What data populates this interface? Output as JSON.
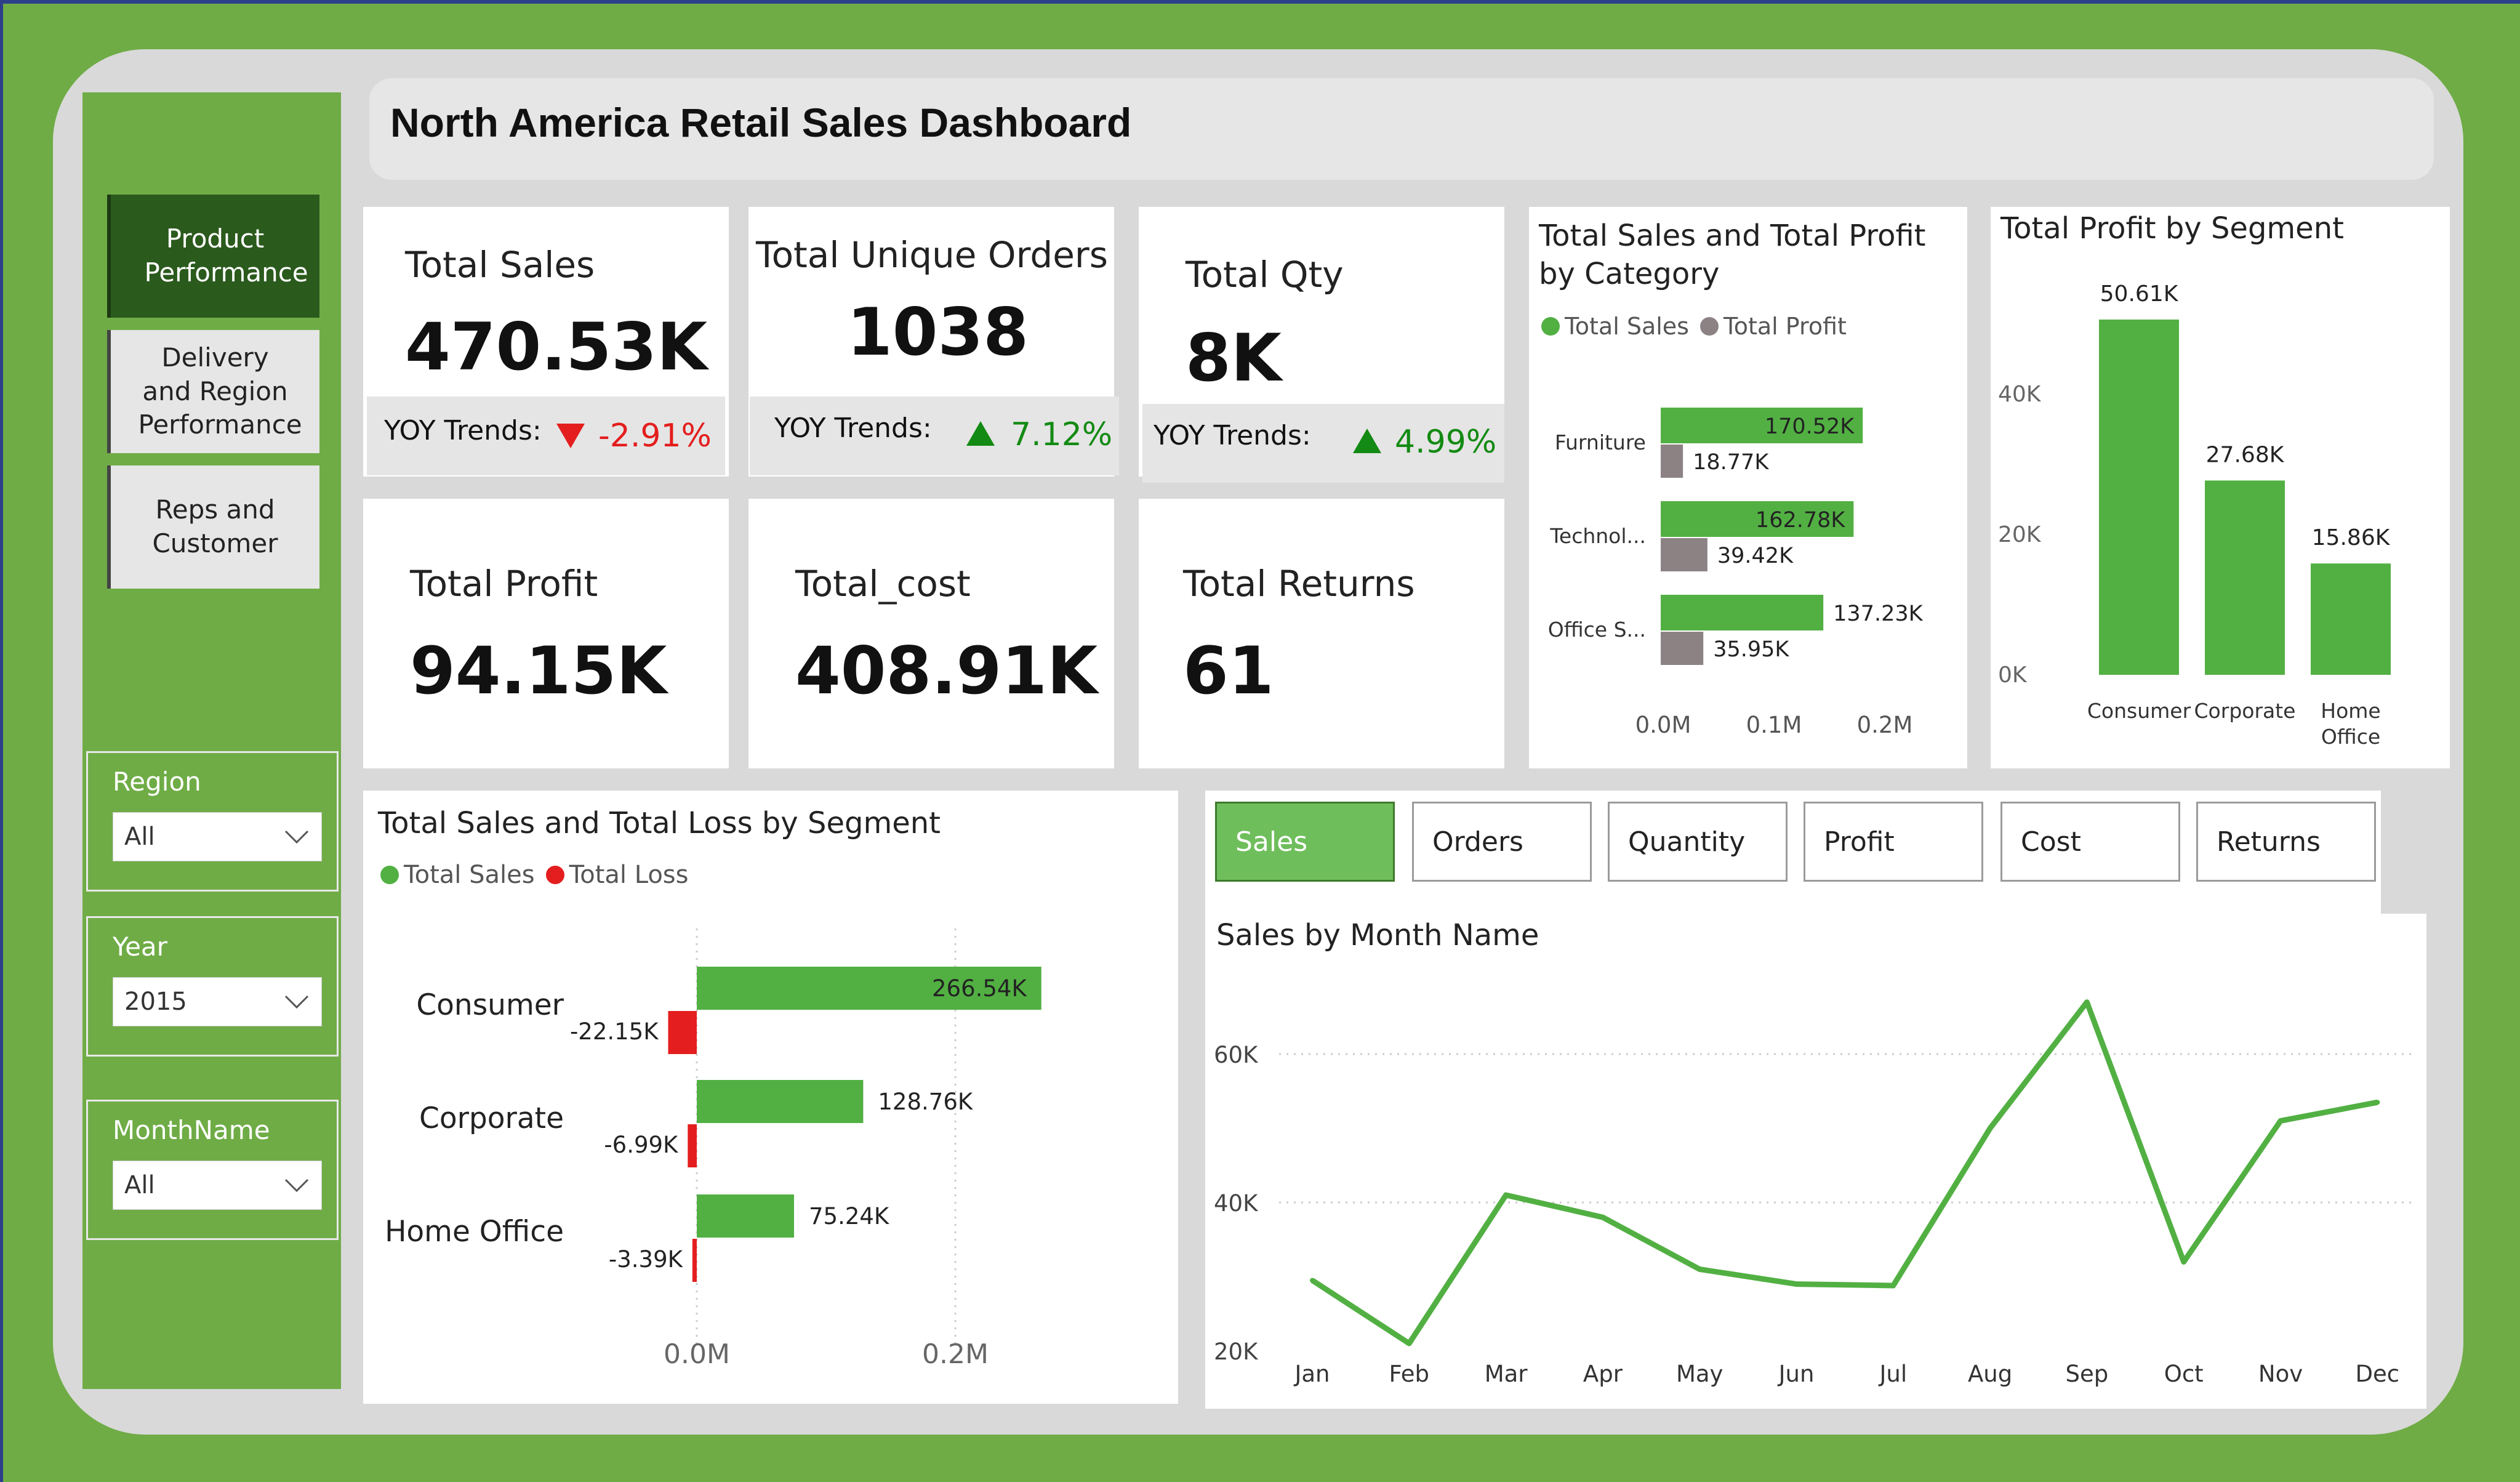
{
  "title": "North America Retail Sales Dashboard",
  "nav": {
    "product": "Product Performance",
    "delivery": "Delivery and Region Performance",
    "reps": "Reps and Customer"
  },
  "slicers": {
    "region": {
      "label": "Region",
      "value": "All"
    },
    "year": {
      "label": "Year",
      "value": "2015"
    },
    "month": {
      "label": "MonthName",
      "value": "All"
    }
  },
  "kpis": {
    "sales": {
      "label": "Total Sales",
      "value": "470.53K",
      "yoy_label": "YOY Trends:",
      "yoy": "-2.91%",
      "direction": "down"
    },
    "orders": {
      "label": "Total Unique Orders",
      "value": "1038",
      "yoy_label": "YOY Trends:",
      "yoy": "7.12%",
      "direction": "up"
    },
    "qty": {
      "label": "Total Qty",
      "value": "8K",
      "yoy_label": "YOY Trends:",
      "yoy": "4.99%",
      "direction": "up"
    },
    "profit": {
      "label": "Total Profit",
      "value": "94.15K"
    },
    "cost": {
      "label": "Total_cost",
      "value": "408.91K"
    },
    "returns": {
      "label": "Total Returns",
      "value": "61"
    }
  },
  "tabs": [
    "Sales",
    "Orders",
    "Quantity",
    "Profit",
    "Cost",
    "Returns"
  ],
  "colors": {
    "green": "#52b043",
    "grey": "#8c8284",
    "red": "#e41e1e",
    "accent": "#6fac46"
  },
  "chart_data": [
    {
      "id": "category",
      "type": "bar",
      "title": "Total Sales and Total Profit by Category",
      "legend": [
        "Total Sales",
        "Total Profit"
      ],
      "categories": [
        "Furniture",
        "Technol...",
        "Office S..."
      ],
      "series": [
        {
          "name": "Total Sales",
          "values": [
            170520,
            162780,
            137230
          ],
          "labels": [
            "170.52K",
            "162.78K",
            "137.23K"
          ]
        },
        {
          "name": "Total Profit",
          "values": [
            18770,
            39420,
            35950
          ],
          "labels": [
            "18.77K",
            "39.42K",
            "35.95K"
          ]
        }
      ],
      "xticks": [
        "0.0M",
        "0.1M",
        "0.2M"
      ],
      "xlim": [
        0,
        200000
      ]
    },
    {
      "id": "segment_profit",
      "type": "bar",
      "title": "Total Profit by Segment",
      "categories": [
        "Consumer",
        "Corporate",
        "Home Office"
      ],
      "values": [
        50610,
        27680,
        15860
      ],
      "labels": [
        "50.61K",
        "27.68K",
        "15.86K"
      ],
      "yticks": [
        "0K",
        "20K",
        "40K"
      ],
      "ylim": [
        0,
        50610
      ]
    },
    {
      "id": "segment_loss",
      "type": "bar",
      "title": "Total Sales and Total Loss by Segment",
      "legend": [
        "Total Sales",
        "Total Loss"
      ],
      "categories": [
        "Consumer",
        "Corporate",
        "Home Office"
      ],
      "series": [
        {
          "name": "Total Sales",
          "values": [
            266540,
            128760,
            75240
          ],
          "labels": [
            "266.54K",
            "128.76K",
            "75.24K"
          ]
        },
        {
          "name": "Total Loss",
          "values": [
            -22150,
            -6990,
            -3390
          ],
          "labels": [
            "-22.15K",
            "-6.99K",
            "-3.39K"
          ]
        }
      ],
      "xticks": [
        "0.0M",
        "0.2M"
      ],
      "xlim": [
        -50000,
        300000
      ]
    },
    {
      "id": "month",
      "type": "line",
      "title": "Sales by Month Name",
      "categories": [
        "Jan",
        "Feb",
        "Mar",
        "Apr",
        "May",
        "Jun",
        "Jul",
        "Aug",
        "Sep",
        "Oct",
        "Nov",
        "Dec"
      ],
      "values": [
        29500,
        21000,
        41000,
        38000,
        31000,
        29000,
        28800,
        50000,
        67000,
        32000,
        51000,
        53500
      ],
      "yticks": [
        "20K",
        "40K",
        "60K"
      ],
      "ylim": [
        20000,
        70000
      ]
    }
  ]
}
